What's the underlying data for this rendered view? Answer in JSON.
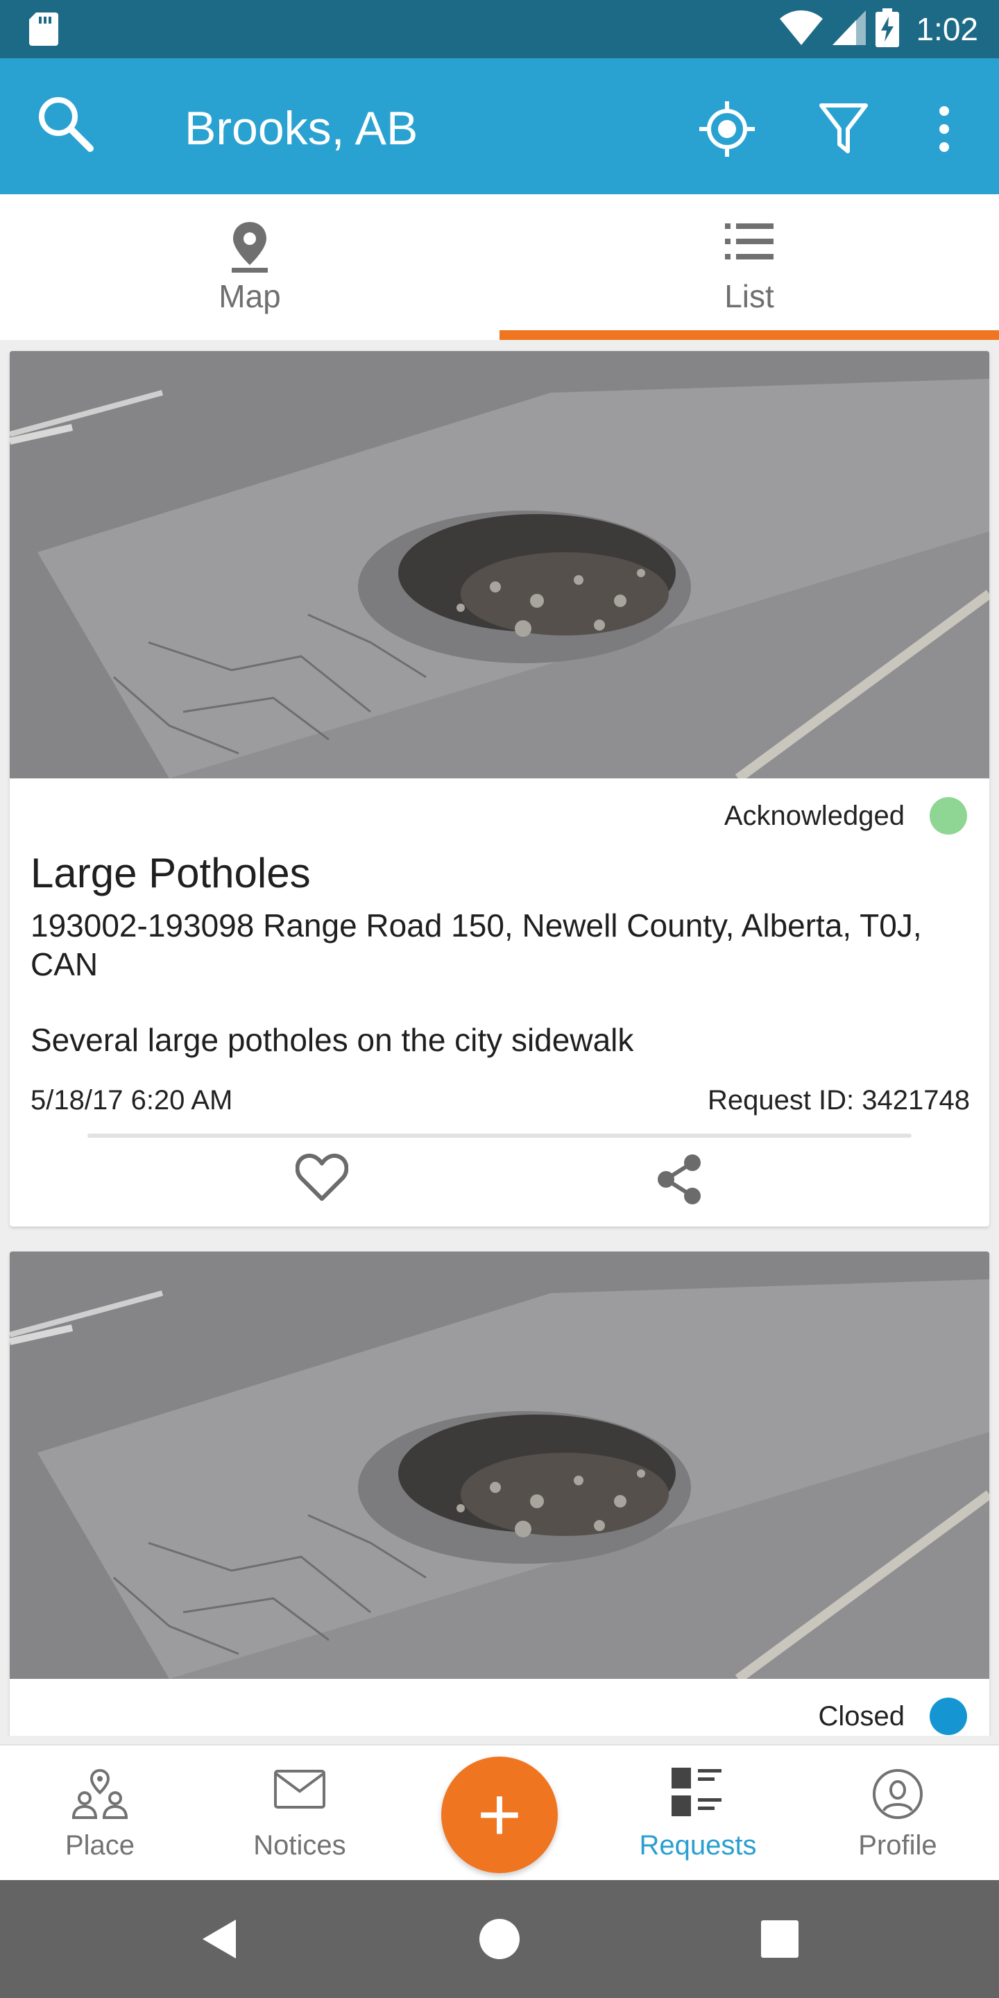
{
  "status_bar": {
    "time": "1:02",
    "icons": [
      "sd-card-icon",
      "wifi-icon",
      "signal-icon",
      "battery-charging-icon"
    ]
  },
  "app_bar": {
    "title": "Brooks, AB",
    "icons": [
      "search-icon",
      "my-location-icon",
      "filter-icon",
      "more-vert-icon"
    ]
  },
  "tabs": [
    {
      "label": "Map",
      "icon": "map-pin-icon",
      "selected": false
    },
    {
      "label": "List",
      "icon": "list-icon",
      "selected": true
    }
  ],
  "requests": [
    {
      "status": "Acknowledged",
      "status_color": "#8fd593",
      "title": "Large Potholes",
      "address": "193002-193098 Range Road 150, Newell County, Alberta, T0J, CAN",
      "description": "Several large potholes on the city sidewalk",
      "date": "5/18/17 6:20 AM",
      "request_id": "Request ID: 3421748"
    },
    {
      "status": "Closed",
      "status_color": "#1596d2"
    }
  ],
  "bottom_nav": {
    "items": [
      {
        "label": "Place",
        "icon": "place-people-icon"
      },
      {
        "label": "Notices",
        "icon": "mail-icon"
      },
      {
        "label": "Requests",
        "icon": "requests-icon",
        "active": true
      },
      {
        "label": "Profile",
        "icon": "profile-icon"
      }
    ],
    "fab_label": "+"
  },
  "colors": {
    "primary": "#2aa2d1",
    "status_bar": "#1d6a87",
    "accent": "#ef7520"
  }
}
